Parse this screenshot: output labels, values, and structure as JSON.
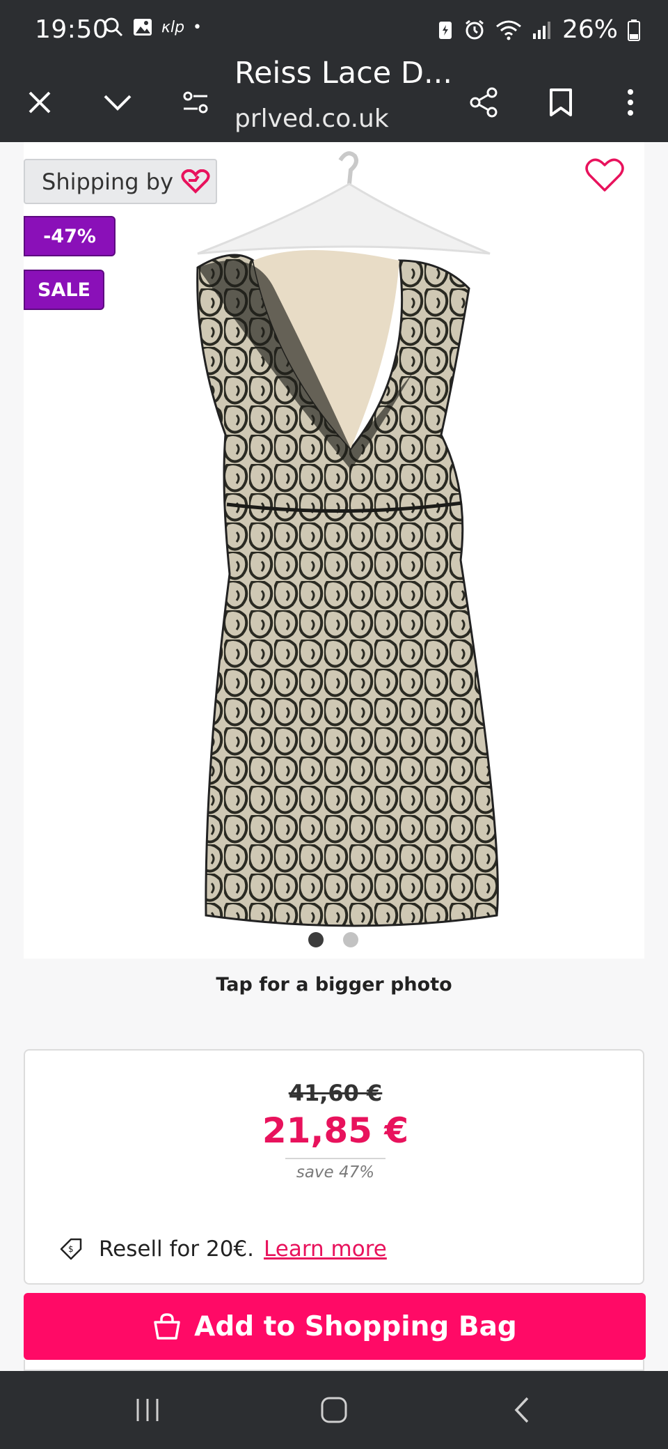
{
  "status_bar": {
    "time": "19:50",
    "battery": "26%"
  },
  "toolbar": {
    "title": "Reiss Lace D...",
    "url": "prlved.co.uk",
    "icons": [
      "close-icon",
      "chevron-down-icon",
      "tune-icon",
      "share-icon",
      "bookmark-icon",
      "more-vertical-icon"
    ]
  },
  "product": {
    "shipping_label": "Shipping by",
    "discount_tag": "-47%",
    "sale_tag": "SALE",
    "tap_hint": "Tap for a bigger photo",
    "carousel": {
      "total": 2,
      "active": 1
    },
    "image_alt": "Black lace dress on hanger"
  },
  "price": {
    "old": "41,60 €",
    "current": "21,85 €",
    "save": "save 47%"
  },
  "resell": {
    "text": "Resell for 20€.",
    "link": "Learn more"
  },
  "cta": {
    "label": "Add to Shopping Bag"
  },
  "colors": {
    "accent": "#ff0a66",
    "price": "#e8125c",
    "tag": "#8a10b8",
    "chrome": "#2c2e31"
  }
}
